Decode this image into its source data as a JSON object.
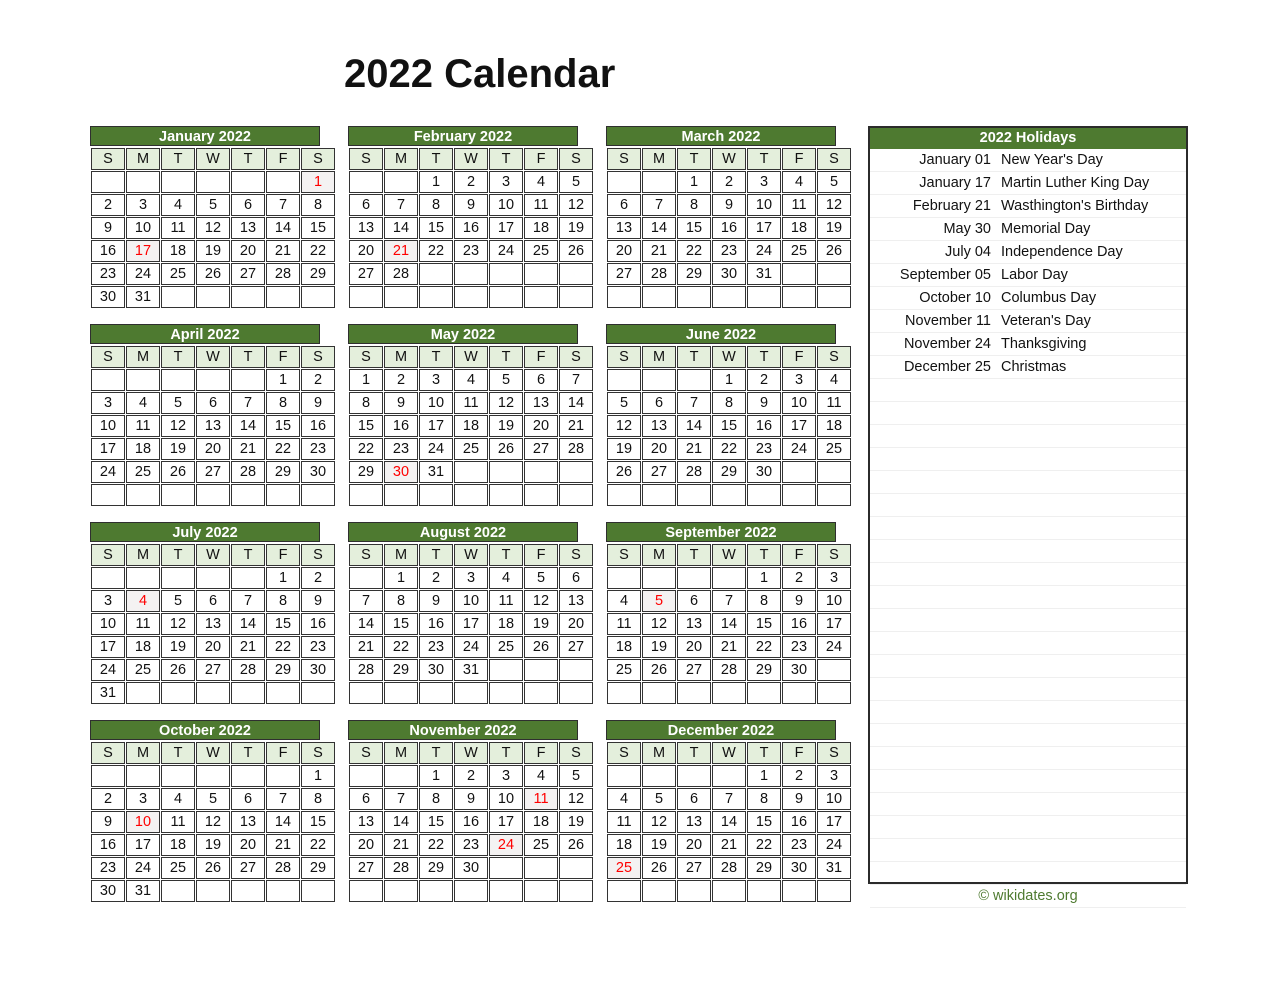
{
  "title": "2022 Calendar",
  "attribution": "© wikidates.org",
  "weekday_headers": [
    "S",
    "M",
    "T",
    "W",
    "T",
    "F",
    "S"
  ],
  "holidays_panel": {
    "title": "2022 Holidays",
    "items": [
      {
        "date": "January 01",
        "name": "New Year's Day"
      },
      {
        "date": "January 17",
        "name": "Martin Luther King Day"
      },
      {
        "date": "February 21",
        "name": "Wasthington's Birthday"
      },
      {
        "date": "May 30",
        "name": "Memorial Day"
      },
      {
        "date": "July 04",
        "name": "Independence Day"
      },
      {
        "date": "September 05",
        "name": "Labor Day"
      },
      {
        "date": "October 10",
        "name": "Columbus Day"
      },
      {
        "date": "November 11",
        "name": "Veteran's Day"
      },
      {
        "date": "November 24",
        "name": "Thanksgiving"
      },
      {
        "date": "December 25",
        "name": "Christmas"
      }
    ],
    "blank_row_count": 23
  },
  "colors": {
    "header_green": "#4E7A30",
    "weekday_header_bg": "#E4EFDC",
    "holiday_red": "#FF0000",
    "holiday_cell_bg": "#F4F2F2",
    "attribution_green": "#4E7A30",
    "grid_border": "#333333"
  },
  "months": [
    {
      "name": "January 2022",
      "weeks": [
        [
          "",
          "",
          "",
          "",
          "",
          "",
          "1"
        ],
        [
          "2",
          "3",
          "4",
          "5",
          "6",
          "7",
          "8"
        ],
        [
          "9",
          "10",
          "11",
          "12",
          "13",
          "14",
          "15"
        ],
        [
          "16",
          "17",
          "18",
          "19",
          "20",
          "21",
          "22"
        ],
        [
          "23",
          "24",
          "25",
          "26",
          "27",
          "28",
          "29"
        ],
        [
          "30",
          "31",
          "",
          "",
          "",
          "",
          ""
        ]
      ],
      "holidays": [
        "1",
        "17"
      ]
    },
    {
      "name": "February 2022",
      "weeks": [
        [
          "",
          "",
          "1",
          "2",
          "3",
          "4",
          "5"
        ],
        [
          "6",
          "7",
          "8",
          "9",
          "10",
          "11",
          "12"
        ],
        [
          "13",
          "14",
          "15",
          "16",
          "17",
          "18",
          "19"
        ],
        [
          "20",
          "21",
          "22",
          "23",
          "24",
          "25",
          "26"
        ],
        [
          "27",
          "28",
          "",
          "",
          "",
          "",
          ""
        ],
        [
          "",
          "",
          "",
          "",
          "",
          "",
          ""
        ]
      ],
      "holidays": [
        "21"
      ]
    },
    {
      "name": "March 2022",
      "weeks": [
        [
          "",
          "",
          "1",
          "2",
          "3",
          "4",
          "5"
        ],
        [
          "6",
          "7",
          "8",
          "9",
          "10",
          "11",
          "12"
        ],
        [
          "13",
          "14",
          "15",
          "16",
          "17",
          "18",
          "19"
        ],
        [
          "20",
          "21",
          "22",
          "23",
          "24",
          "25",
          "26"
        ],
        [
          "27",
          "28",
          "29",
          "30",
          "31",
          "",
          ""
        ],
        [
          "",
          "",
          "",
          "",
          "",
          "",
          ""
        ]
      ],
      "holidays": []
    },
    {
      "name": "April 2022",
      "weeks": [
        [
          "",
          "",
          "",
          "",
          "",
          "1",
          "2"
        ],
        [
          "3",
          "4",
          "5",
          "6",
          "7",
          "8",
          "9"
        ],
        [
          "10",
          "11",
          "12",
          "13",
          "14",
          "15",
          "16"
        ],
        [
          "17",
          "18",
          "19",
          "20",
          "21",
          "22",
          "23"
        ],
        [
          "24",
          "25",
          "26",
          "27",
          "28",
          "29",
          "30"
        ],
        [
          "",
          "",
          "",
          "",
          "",
          "",
          ""
        ]
      ],
      "holidays": []
    },
    {
      "name": "May 2022",
      "weeks": [
        [
          "1",
          "2",
          "3",
          "4",
          "5",
          "6",
          "7"
        ],
        [
          "8",
          "9",
          "10",
          "11",
          "12",
          "13",
          "14"
        ],
        [
          "15",
          "16",
          "17",
          "18",
          "19",
          "20",
          "21"
        ],
        [
          "22",
          "23",
          "24",
          "25",
          "26",
          "27",
          "28"
        ],
        [
          "29",
          "30",
          "31",
          "",
          "",
          "",
          ""
        ],
        [
          "",
          "",
          "",
          "",
          "",
          "",
          ""
        ]
      ],
      "holidays": [
        "30"
      ]
    },
    {
      "name": "June 2022",
      "weeks": [
        [
          "",
          "",
          "",
          "1",
          "2",
          "3",
          "4"
        ],
        [
          "5",
          "6",
          "7",
          "8",
          "9",
          "10",
          "11"
        ],
        [
          "12",
          "13",
          "14",
          "15",
          "16",
          "17",
          "18"
        ],
        [
          "19",
          "20",
          "21",
          "22",
          "23",
          "24",
          "25"
        ],
        [
          "26",
          "27",
          "28",
          "29",
          "30",
          "",
          ""
        ],
        [
          "",
          "",
          "",
          "",
          "",
          "",
          ""
        ]
      ],
      "holidays": []
    },
    {
      "name": "July 2022",
      "weeks": [
        [
          "",
          "",
          "",
          "",
          "",
          "1",
          "2"
        ],
        [
          "3",
          "4",
          "5",
          "6",
          "7",
          "8",
          "9"
        ],
        [
          "10",
          "11",
          "12",
          "13",
          "14",
          "15",
          "16"
        ],
        [
          "17",
          "18",
          "19",
          "20",
          "21",
          "22",
          "23"
        ],
        [
          "24",
          "25",
          "26",
          "27",
          "28",
          "29",
          "30"
        ],
        [
          "31",
          "",
          "",
          "",
          "",
          "",
          ""
        ]
      ],
      "holidays": [
        "4"
      ]
    },
    {
      "name": "August 2022",
      "weeks": [
        [
          "",
          "1",
          "2",
          "3",
          "4",
          "5",
          "6"
        ],
        [
          "7",
          "8",
          "9",
          "10",
          "11",
          "12",
          "13"
        ],
        [
          "14",
          "15",
          "16",
          "17",
          "18",
          "19",
          "20"
        ],
        [
          "21",
          "22",
          "23",
          "24",
          "25",
          "26",
          "27"
        ],
        [
          "28",
          "29",
          "30",
          "31",
          "",
          "",
          ""
        ],
        [
          "",
          "",
          "",
          "",
          "",
          "",
          ""
        ]
      ],
      "holidays": []
    },
    {
      "name": "September 2022",
      "weeks": [
        [
          "",
          "",
          "",
          "",
          "1",
          "2",
          "3"
        ],
        [
          "4",
          "5",
          "6",
          "7",
          "8",
          "9",
          "10"
        ],
        [
          "11",
          "12",
          "13",
          "14",
          "15",
          "16",
          "17"
        ],
        [
          "18",
          "19",
          "20",
          "21",
          "22",
          "23",
          "24"
        ],
        [
          "25",
          "26",
          "27",
          "28",
          "29",
          "30",
          ""
        ],
        [
          "",
          "",
          "",
          "",
          "",
          "",
          ""
        ]
      ],
      "holidays": [
        "5"
      ]
    },
    {
      "name": "October 2022",
      "weeks": [
        [
          "",
          "",
          "",
          "",
          "",
          "",
          "1"
        ],
        [
          "2",
          "3",
          "4",
          "5",
          "6",
          "7",
          "8"
        ],
        [
          "9",
          "10",
          "11",
          "12",
          "13",
          "14",
          "15"
        ],
        [
          "16",
          "17",
          "18",
          "19",
          "20",
          "21",
          "22"
        ],
        [
          "23",
          "24",
          "25",
          "26",
          "27",
          "28",
          "29"
        ],
        [
          "30",
          "31",
          "",
          "",
          "",
          "",
          ""
        ]
      ],
      "holidays": [
        "10"
      ]
    },
    {
      "name": "November 2022",
      "weeks": [
        [
          "",
          "",
          "1",
          "2",
          "3",
          "4",
          "5"
        ],
        [
          "6",
          "7",
          "8",
          "9",
          "10",
          "11",
          "12"
        ],
        [
          "13",
          "14",
          "15",
          "16",
          "17",
          "18",
          "19"
        ],
        [
          "20",
          "21",
          "22",
          "23",
          "24",
          "25",
          "26"
        ],
        [
          "27",
          "28",
          "29",
          "30",
          "",
          "",
          ""
        ],
        [
          "",
          "",
          "",
          "",
          "",
          "",
          ""
        ]
      ],
      "holidays": [
        "11",
        "24"
      ]
    },
    {
      "name": "December 2022",
      "weeks": [
        [
          "",
          "",
          "",
          "",
          "1",
          "2",
          "3"
        ],
        [
          "4",
          "5",
          "6",
          "7",
          "8",
          "9",
          "10"
        ],
        [
          "11",
          "12",
          "13",
          "14",
          "15",
          "16",
          "17"
        ],
        [
          "18",
          "19",
          "20",
          "21",
          "22",
          "23",
          "24"
        ],
        [
          "25",
          "26",
          "27",
          "28",
          "29",
          "30",
          "31"
        ],
        [
          "",
          "",
          "",
          "",
          "",
          "",
          ""
        ]
      ],
      "holidays": [
        "25"
      ]
    }
  ]
}
